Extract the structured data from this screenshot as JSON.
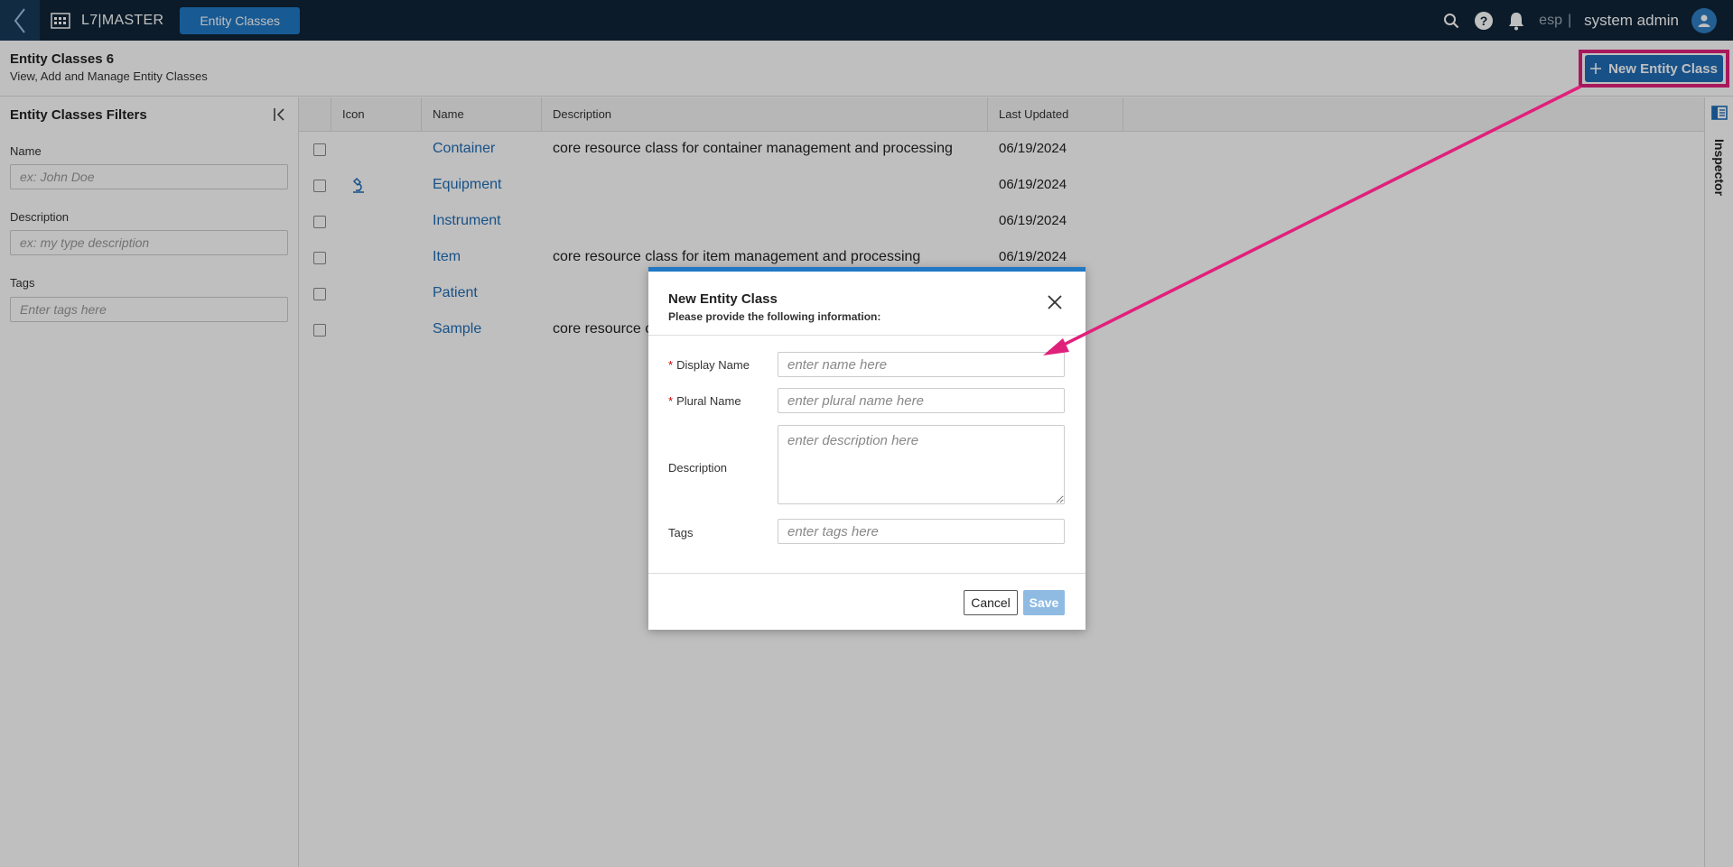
{
  "topbar": {
    "brand": "L7|MASTER",
    "active_tab": "Entity Classes",
    "lang": "esp",
    "separator": "|",
    "user": "system admin"
  },
  "header": {
    "title": "Entity Classes 6",
    "subtitle": "View, Add and Manage Entity Classes",
    "new_button": "New Entity Class"
  },
  "filters": {
    "title": "Entity Classes Filters",
    "name_label": "Name",
    "name_placeholder": "ex: John Doe",
    "description_label": "Description",
    "description_placeholder": "ex: my type description",
    "tags_label": "Tags",
    "tags_placeholder": "Enter tags here"
  },
  "table": {
    "columns": [
      "Icon",
      "Name",
      "Description",
      "Last Updated"
    ],
    "rows": [
      {
        "name": "Container",
        "description": "core resource class for container management and processing",
        "updated": "06/19/2024",
        "icon": ""
      },
      {
        "name": "Equipment",
        "description": "",
        "updated": "06/19/2024",
        "icon": "microscope-icon"
      },
      {
        "name": "Instrument",
        "description": "",
        "updated": "06/19/2024",
        "icon": ""
      },
      {
        "name": "Item",
        "description": "core resource class for item management and processing",
        "updated": "06/19/2024",
        "icon": ""
      },
      {
        "name": "Patient",
        "description": "",
        "updated": "",
        "icon": ""
      },
      {
        "name": "Sample",
        "description": "core resource c",
        "updated": "",
        "icon": ""
      }
    ]
  },
  "inspector": {
    "label": "Inspector"
  },
  "modal": {
    "title": "New Entity Class",
    "subtitle": "Please provide the following information:",
    "display_name_label": "Display Name",
    "display_name_placeholder": "enter name here",
    "plural_name_label": "Plural Name",
    "plural_name_placeholder": "enter plural name here",
    "description_label": "Description",
    "description_placeholder": "enter description here",
    "tags_label": "Tags",
    "tags_placeholder": "enter tags here",
    "required_mark": "*",
    "cancel": "Cancel",
    "save": "Save"
  },
  "colors": {
    "accent": "#2178c4",
    "highlight": "#e0217b",
    "topbar": "#0f2438"
  }
}
